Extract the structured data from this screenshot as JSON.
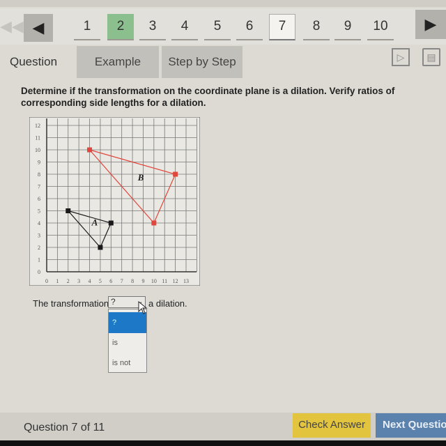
{
  "nav": {
    "first_icon": "double-chevron-left-icon",
    "prev_icon": "triangle-left-icon",
    "next_icon": "triangle-right-icon",
    "questions": [
      {
        "label": "1",
        "state": "normal"
      },
      {
        "label": "2",
        "state": "answered"
      },
      {
        "label": "3",
        "state": "normal"
      },
      {
        "label": "4",
        "state": "normal"
      },
      {
        "label": "5",
        "state": "normal"
      },
      {
        "label": "6",
        "state": "normal"
      },
      {
        "label": "7",
        "state": "current"
      },
      {
        "label": "8",
        "state": "normal"
      },
      {
        "label": "9",
        "state": "normal"
      },
      {
        "label": "10",
        "state": "normal"
      }
    ]
  },
  "tabs": {
    "question": "Question",
    "example": "Example",
    "step_by_step": "Step by Step",
    "video_icon": "play-video-icon",
    "book_icon": "open-book-icon"
  },
  "prompt": "Determine if the transformation on the coordinate plane is a dilation. Verify ratios of corresponding side lengths for a dilation.",
  "graph": {
    "x_ticks": [
      "0",
      "1",
      "2",
      "3",
      "4",
      "5",
      "6",
      "7",
      "8",
      "9",
      "10",
      "11",
      "12",
      "13"
    ],
    "y_ticks": [
      "0",
      "1",
      "2",
      "3",
      "4",
      "5",
      "6",
      "7",
      "8",
      "9",
      "10",
      "11",
      "12"
    ],
    "xlim": [
      0,
      13
    ],
    "ylim": [
      0,
      12
    ],
    "triangles": [
      {
        "label": "A",
        "color": "#1a1a1a",
        "vertices": [
          [
            2,
            5
          ],
          [
            6,
            4
          ],
          [
            5,
            2
          ]
        ],
        "label_pos": [
          4.2,
          3.8
        ]
      },
      {
        "label": "B",
        "color": "#e0463c",
        "vertices": [
          [
            4,
            10
          ],
          [
            12,
            8
          ],
          [
            10,
            4
          ]
        ],
        "label_pos": [
          8.5,
          7.5
        ]
      }
    ]
  },
  "answer": {
    "prefix": "The transformation",
    "selected": "?",
    "suffix": "a dilation.",
    "options": [
      "?",
      "is",
      "is not"
    ],
    "highlighted_index": 0
  },
  "footer": {
    "question_label": "Question",
    "question_num": "7",
    "of_label": "of 11",
    "check_answer": "Check Answer",
    "next_question": "Next Question"
  },
  "colors": {
    "answered": "#8cbf8e",
    "check": "#e3c43e",
    "next": "#5b82ac",
    "highlight": "#1e78c8"
  }
}
